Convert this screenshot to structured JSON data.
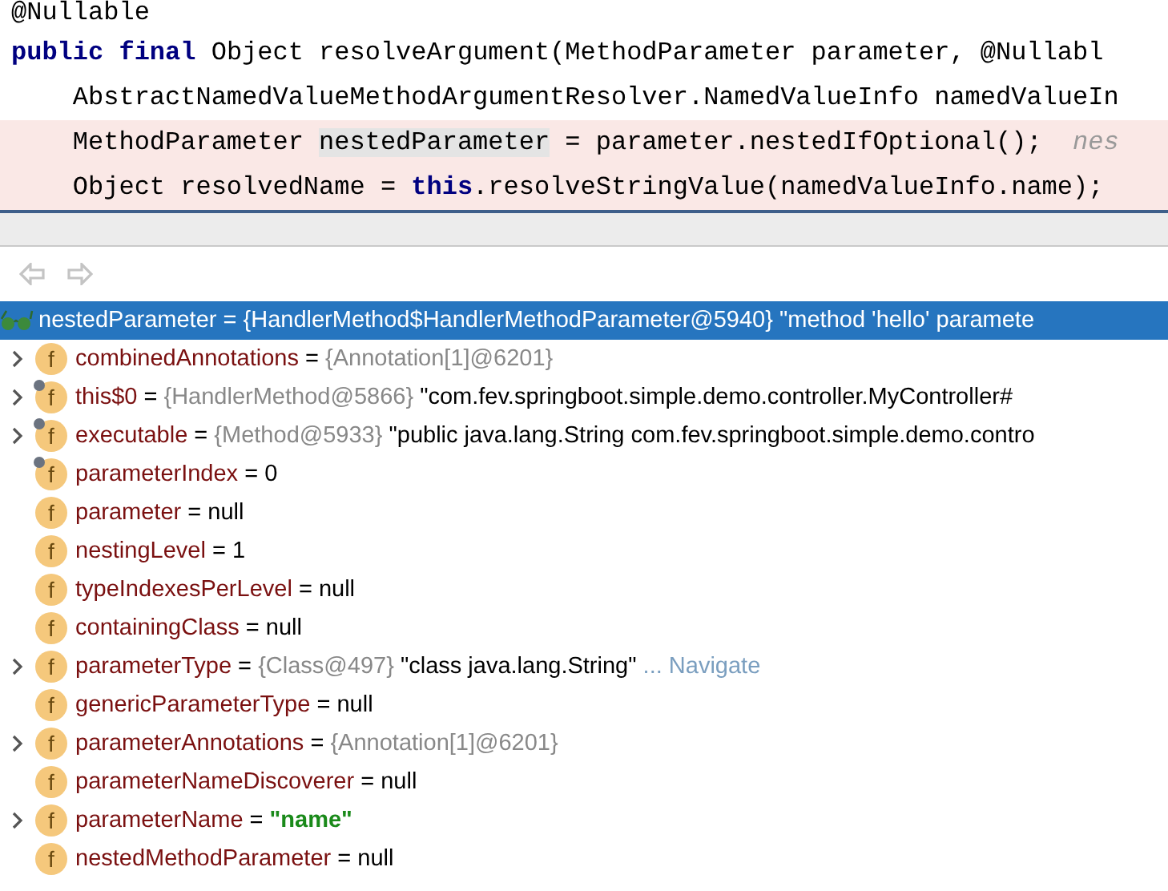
{
  "code_lines": [
    {
      "highlighted": false,
      "tokens": [
        {
          "kind": "text",
          "text": "@Nullable"
        }
      ]
    },
    {
      "highlighted": false,
      "tokens": [
        {
          "kind": "kw",
          "text": "public "
        },
        {
          "kind": "kw",
          "text": "final"
        },
        {
          "kind": "text",
          "text": " Object resolveArgument(MethodParameter parameter, @Nullabl"
        }
      ]
    },
    {
      "highlighted": false,
      "tokens": [
        {
          "kind": "text",
          "text": "    AbstractNamedValueMethodArgumentResolver.NamedValueInfo namedValueIn"
        }
      ]
    },
    {
      "highlighted": true,
      "tokens": [
        {
          "kind": "text",
          "text": "    MethodParameter "
        },
        {
          "kind": "mark",
          "text": "nestedParameter"
        },
        {
          "kind": "text",
          "text": " = parameter.nestedIfOptional();  "
        },
        {
          "kind": "hint",
          "text": "nes"
        }
      ]
    },
    {
      "highlighted": true,
      "tokens": [
        {
          "kind": "text",
          "text": "    Object resolvedName = "
        },
        {
          "kind": "kw",
          "text": "this"
        },
        {
          "kind": "text",
          "text": ".resolveStringValue(namedValueInfo.name);"
        }
      ]
    }
  ],
  "toolbar": {
    "back_disabled": true,
    "forward_disabled": true
  },
  "variables": [
    {
      "kind": "watch",
      "selected": true,
      "expandable": false,
      "name": "nestedParameter",
      "op": "=",
      "value": [
        {
          "kind": "ref",
          "text": "{HandlerMethod$HandlerMethodParameter@5940}"
        },
        {
          "kind": "string",
          "text": "\"method 'hello' paramete"
        }
      ]
    },
    {
      "kind": "field",
      "icon": "f",
      "selected": false,
      "expandable": true,
      "badge": false,
      "name": "combinedAnnotations",
      "op": "=",
      "value": [
        {
          "kind": "ref",
          "text": "{Annotation[1]@6201}"
        }
      ]
    },
    {
      "kind": "field",
      "icon": "f",
      "selected": false,
      "expandable": true,
      "badge": true,
      "name": "this$0",
      "op": "=",
      "value": [
        {
          "kind": "ref",
          "text": "{HandlerMethod@5866}"
        },
        {
          "kind": "string",
          "text": "\"com.fev.springboot.simple.demo.controller.MyController#"
        }
      ]
    },
    {
      "kind": "field",
      "icon": "f",
      "selected": false,
      "expandable": true,
      "badge": true,
      "name": "executable",
      "op": "=",
      "value": [
        {
          "kind": "ref",
          "text": "{Method@5933}"
        },
        {
          "kind": "string",
          "text": "\"public java.lang.String com.fev.springboot.simple.demo.contro"
        }
      ]
    },
    {
      "kind": "field",
      "icon": "f",
      "selected": false,
      "expandable": false,
      "badge": true,
      "name": "parameterIndex",
      "op": "=",
      "value": [
        {
          "kind": "plain",
          "text": "0"
        }
      ]
    },
    {
      "kind": "field",
      "icon": "f",
      "selected": false,
      "expandable": false,
      "badge": false,
      "name": "parameter",
      "op": "=",
      "value": [
        {
          "kind": "plain",
          "text": "null"
        }
      ]
    },
    {
      "kind": "field",
      "icon": "f",
      "selected": false,
      "expandable": false,
      "badge": false,
      "name": "nestingLevel",
      "op": "=",
      "value": [
        {
          "kind": "plain",
          "text": "1"
        }
      ]
    },
    {
      "kind": "field",
      "icon": "f",
      "selected": false,
      "expandable": false,
      "badge": false,
      "name": "typeIndexesPerLevel",
      "op": "=",
      "value": [
        {
          "kind": "plain",
          "text": "null"
        }
      ]
    },
    {
      "kind": "field",
      "icon": "f",
      "selected": false,
      "expandable": false,
      "badge": false,
      "name": "containingClass",
      "op": "=",
      "value": [
        {
          "kind": "plain",
          "text": "null"
        }
      ]
    },
    {
      "kind": "field",
      "icon": "f",
      "selected": false,
      "expandable": true,
      "badge": false,
      "name": "parameterType",
      "op": "=",
      "value": [
        {
          "kind": "ref",
          "text": "{Class@497}"
        },
        {
          "kind": "string",
          "text": "\"class java.lang.String\""
        },
        {
          "kind": "link",
          "text": "... Navigate"
        }
      ]
    },
    {
      "kind": "field",
      "icon": "f",
      "selected": false,
      "expandable": false,
      "badge": false,
      "name": "genericParameterType",
      "op": "=",
      "value": [
        {
          "kind": "plain",
          "text": "null"
        }
      ]
    },
    {
      "kind": "field",
      "icon": "f",
      "selected": false,
      "expandable": true,
      "badge": false,
      "name": "parameterAnnotations",
      "op": "=",
      "value": [
        {
          "kind": "ref",
          "text": "{Annotation[1]@6201}"
        }
      ]
    },
    {
      "kind": "field",
      "icon": "f",
      "selected": false,
      "expandable": false,
      "badge": false,
      "name": "parameterNameDiscoverer",
      "op": "=",
      "value": [
        {
          "kind": "plain",
          "text": "null"
        }
      ]
    },
    {
      "kind": "field",
      "icon": "f",
      "selected": false,
      "expandable": true,
      "badge": false,
      "name": "parameterName",
      "op": "=",
      "value": [
        {
          "kind": "green",
          "text": "\"name\""
        }
      ]
    },
    {
      "kind": "field",
      "icon": "f",
      "selected": false,
      "expandable": false,
      "badge": false,
      "name": "nestedMethodParameter",
      "op": "=",
      "value": [
        {
          "kind": "plain",
          "text": "null"
        }
      ]
    }
  ]
}
